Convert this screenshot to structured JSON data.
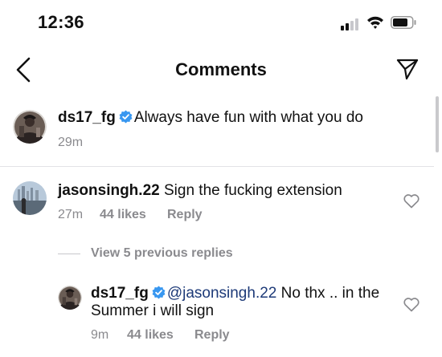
{
  "status_bar": {
    "time": "12:36"
  },
  "header": {
    "title": "Comments"
  },
  "caption": {
    "username": "ds17_fg",
    "text": "Always have fun with what you do",
    "time": "29m"
  },
  "comments": [
    {
      "username": "jasonsingh.22",
      "text": "Sign the fucking extension",
      "time": "27m",
      "likes": "44 likes",
      "reply_label": "Reply"
    }
  ],
  "view_replies": {
    "label": "View 5 previous replies"
  },
  "reply": {
    "username": "ds17_fg",
    "mention": "@jasonsingh.22",
    "text": "No thx .. in the Summer i will sign",
    "time": "9m",
    "likes": "44 likes",
    "reply_label": "Reply"
  },
  "colors": {
    "verified": "#3897f0",
    "secondary_text": "#8a8a8e",
    "mention": "#1d3a78"
  }
}
